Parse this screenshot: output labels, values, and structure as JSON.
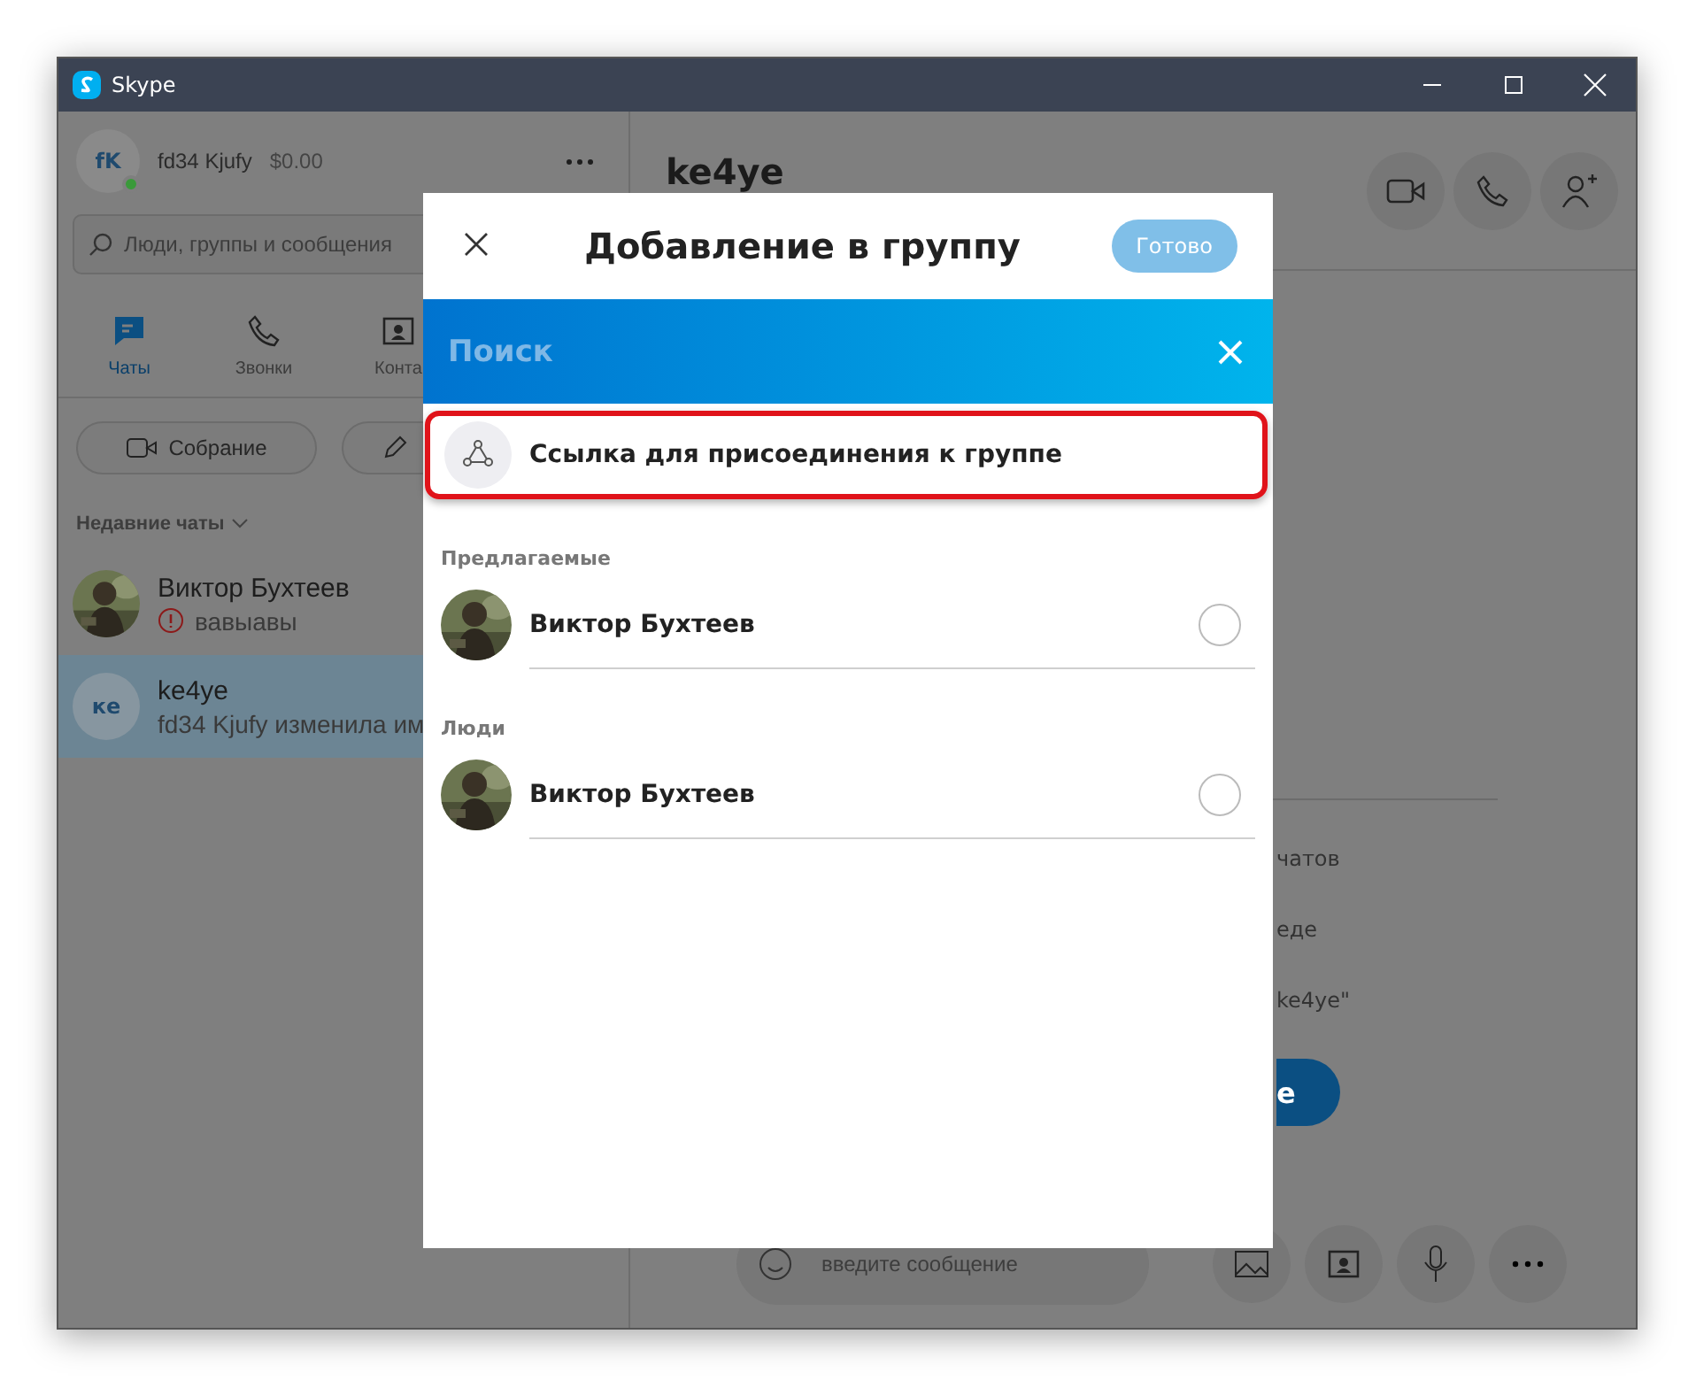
{
  "window": {
    "title": "Skype"
  },
  "sidebar": {
    "profile": {
      "initials": "fK",
      "name": "fd34 Kjufy",
      "balance": "$0.00",
      "online": true
    },
    "search": {
      "placeholder": "Люди, группы и сообщения"
    },
    "tabs": [
      {
        "label": "Чаты",
        "kind": "chats",
        "selected": true
      },
      {
        "label": "Звонки",
        "kind": "calls",
        "selected": false
      },
      {
        "label": "Конта",
        "kind": "contacts",
        "selected": false
      }
    ],
    "meeting_button": "Собрание",
    "recent_label": "Недавние чаты",
    "chats": [
      {
        "name": "Виктор Бухтеев",
        "preview": "вавыавы",
        "error": true,
        "selected": false
      },
      {
        "name": "ke4ye",
        "initials": "ке",
        "preview": "fd34 Kjufy изменила им",
        "kind": "initials",
        "error": false,
        "selected": true
      }
    ]
  },
  "conversation": {
    "title": "ke4ye",
    "info_lines": [
      "чатов",
      "еде",
      "ke4ye\""
    ],
    "action_button": "е",
    "message": {
      "placeholder": "введите сообщение"
    }
  },
  "dialog": {
    "title": "Добавление в группу",
    "done_button": {
      "label": "Готово",
      "disabled": true
    },
    "search": {
      "placeholder": "Поиск"
    },
    "link_row": {
      "label": "Ссылка для присоединения к группе",
      "highlighted": true
    },
    "sections": [
      {
        "heading": "Предлагаемые",
        "contacts": [
          {
            "name": "Виктор Бухтеев",
            "checked": false
          }
        ]
      },
      {
        "heading": "Люди",
        "contacts": [
          {
            "name": "Виктор Бухтеев",
            "checked": false
          }
        ]
      }
    ]
  }
}
